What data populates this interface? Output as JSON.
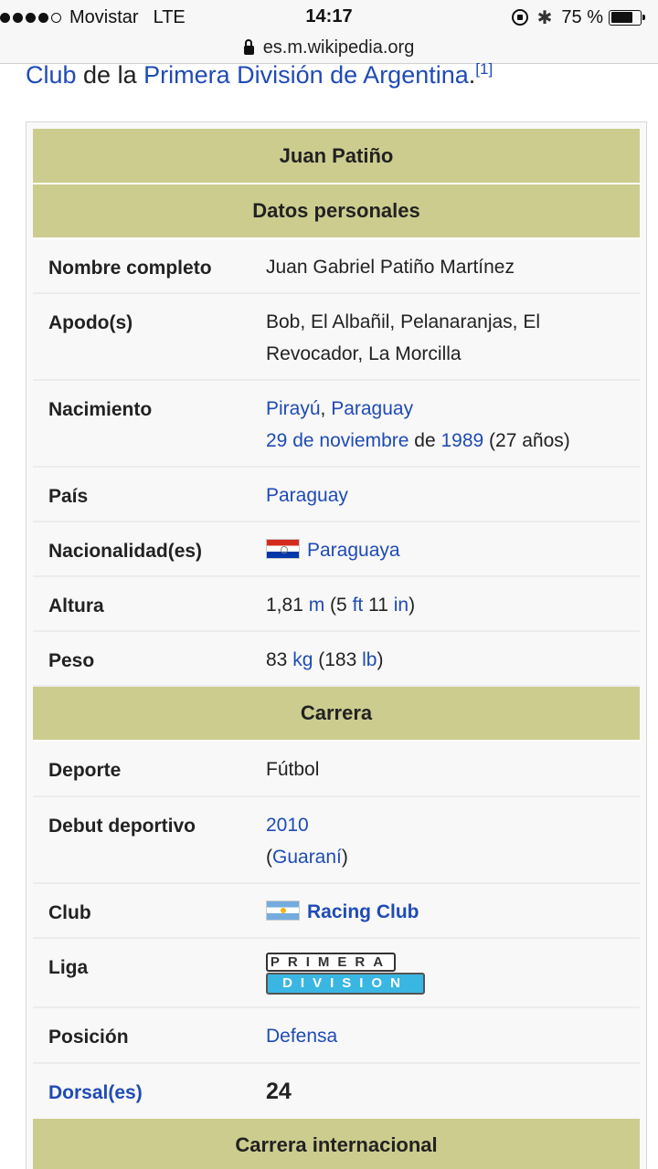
{
  "status": {
    "carrier": "Movistar",
    "network": "LTE",
    "time": "14:17",
    "battery": "75 %"
  },
  "url": "es.m.wikipedia.org",
  "intro": {
    "link1": "Club",
    "text1": " de la ",
    "link2": "Primera División de Argentina",
    "text2": ".",
    "ref": "[1]"
  },
  "infobox": {
    "title": "Juan Patiño",
    "section_personal": "Datos personales",
    "nombre_label": "Nombre completo",
    "nombre_value": "Juan Gabriel Patiño Martínez",
    "apodo_label": "Apodo(s)",
    "apodo_value": "Bob, El Albañil, Pelanaranjas, El Revocador, La Morcilla",
    "nacimiento_label": "Nacimiento",
    "nacimiento_place": "Pirayú",
    "nacimiento_comma": ", ",
    "nacimiento_country": "Paraguay",
    "nacimiento_date": "29 de noviembre",
    "nacimiento_de": " de ",
    "nacimiento_year": "1989",
    "nacimiento_age": " (27 años)",
    "pais_label": "País",
    "pais_value": "Paraguay",
    "nacionalidad_label": "Nacionalidad(es)",
    "nacionalidad_value": "Paraguaya",
    "altura_label": "Altura",
    "altura_num": "1,81 ",
    "altura_unit": "m",
    "altura_open": " (5 ",
    "altura_ft": "ft",
    "altura_mid": " 11 ",
    "altura_in": "in",
    "altura_close": ")",
    "peso_label": "Peso",
    "peso_num": "83 ",
    "peso_unit": "kg",
    "peso_open": " (183 ",
    "peso_lb": "lb",
    "peso_close": ")",
    "section_carrera": "Carrera",
    "deporte_label": "Deporte",
    "deporte_value": "Fútbol",
    "debut_label": "Debut deportivo",
    "debut_year": "2010",
    "debut_open": "(",
    "debut_club": "Guaraní",
    "debut_close": ")",
    "club_label": "Club",
    "club_value": "Racing Club",
    "liga_label": "Liga",
    "liga_logo_top": "PRIMERA",
    "liga_logo_bottom": "DIVISION",
    "posicion_label": "Posición",
    "posicion_value": "Defensa",
    "dorsal_label": "Dorsal(es)",
    "dorsal_value": "24",
    "section_internacional": "Carrera internacional"
  }
}
